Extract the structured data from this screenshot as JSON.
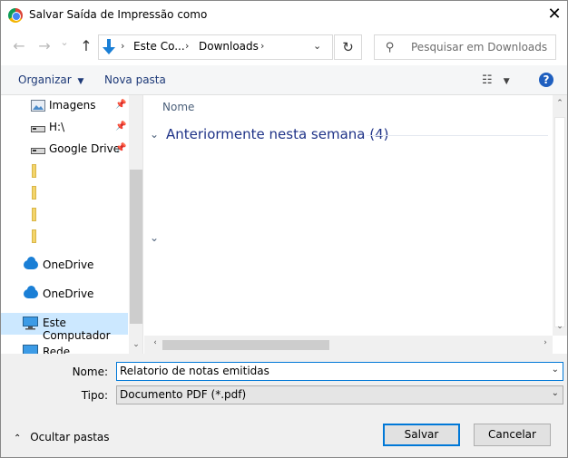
{
  "window": {
    "title": "Salvar Saída de Impressão como",
    "close_glyph": "✕"
  },
  "nav": {
    "back_icon": "←",
    "forward_icon": "→",
    "history_icon": "⌄",
    "up_icon": "↑",
    "breadcrumb": [
      "Este Co...",
      "Downloads"
    ],
    "refresh_icon": "↻",
    "search_placeholder": "Pesquisar em Downloads"
  },
  "toolbar": {
    "organize_label": "Organizar",
    "new_folder_label": "Nova pasta",
    "help_label": "?"
  },
  "sidebar": {
    "items": [
      {
        "label": "Imagens",
        "icon": "pictures-icon",
        "pinned": true
      },
      {
        "label": "H:\\",
        "icon": "drive-icon",
        "pinned": true
      },
      {
        "label": "Google Drive",
        "icon": "drive-icon",
        "pinned": true
      },
      {
        "label": "",
        "icon": "folder-icon"
      },
      {
        "label": "",
        "icon": "folder-icon"
      },
      {
        "label": "",
        "icon": "folder-icon"
      },
      {
        "label": "",
        "icon": "folder-icon"
      },
      {
        "label": "OneDrive",
        "icon": "cloud-icon"
      },
      {
        "label": "OneDrive",
        "icon": "cloud-icon"
      },
      {
        "label": "Este Computador",
        "icon": "computer-icon",
        "selected": true
      },
      {
        "label": "Rede",
        "icon": "network-icon"
      }
    ]
  },
  "content": {
    "column_name": "Nome",
    "group_label": "Anteriormente nesta semana (4)"
  },
  "form": {
    "name_label": "Nome:",
    "name_value": "Relatorio de notas emitidas",
    "type_label": "Tipo:",
    "type_value": "Documento PDF (*.pdf)"
  },
  "footer": {
    "hide_folders_label": "Ocultar pastas",
    "save_label": "Salvar",
    "cancel_label": "Cancelar"
  },
  "colors": {
    "accent": "#0078d7",
    "link_blue": "#1e3287",
    "selected_bg": "#cce8ff"
  }
}
